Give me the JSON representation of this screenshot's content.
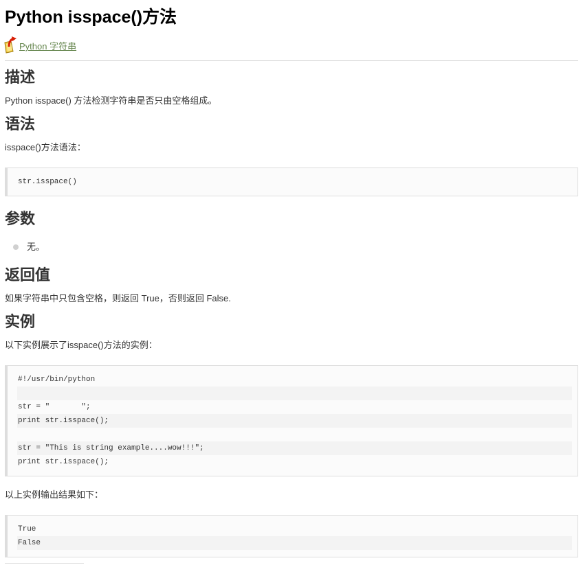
{
  "title": "Python isspace()方法",
  "back_link": {
    "label": " Python 字符串",
    "icon": "return-arrow-folder-icon"
  },
  "sections": {
    "description": {
      "heading": "描述",
      "text": "Python isspace() 方法检测字符串是否只由空格组成。"
    },
    "syntax": {
      "heading": "语法",
      "text": "isspace()方法语法：",
      "code": [
        "str.isspace()"
      ]
    },
    "params": {
      "heading": "参数",
      "items": [
        "无。"
      ]
    },
    "return_value": {
      "heading": "返回值",
      "text": "如果字符串中只包含空格，则返回 True，否则返回 False."
    },
    "example": {
      "heading": "实例",
      "intro": "以下实例展示了isspace()方法的实例：",
      "code": [
        "#!/usr/bin/python",
        "",
        "str = \"       \";",
        "print str.isspace();",
        "",
        "str = \"This is string example....wow!!!\";",
        "print str.isspace();"
      ],
      "output_intro": "以上实例输出结果如下：",
      "output": [
        "True",
        "False"
      ]
    }
  }
}
